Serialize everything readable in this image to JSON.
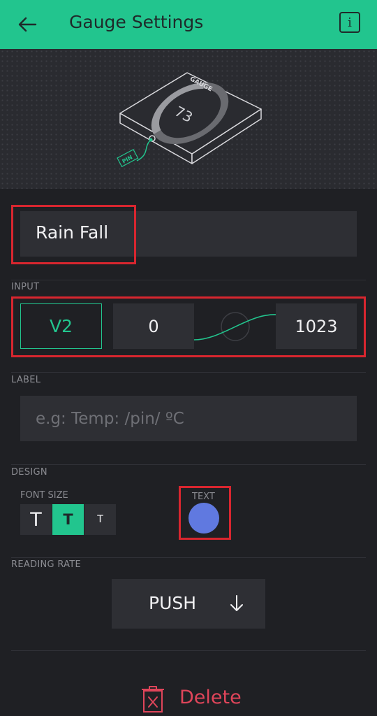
{
  "header": {
    "title": "Gauge Settings",
    "back_icon": "arrow-left-icon",
    "info_icon": "info-icon",
    "info_glyph": "i",
    "color": "#22c58e"
  },
  "preview": {
    "widget_caption": "GAUGE",
    "gauge_value": "73",
    "pin_tag": "PIN"
  },
  "name": {
    "value": "Rain Fall"
  },
  "input": {
    "section_label": "INPUT",
    "pin": "V2",
    "min": "0",
    "max": "1023"
  },
  "label": {
    "section_label": "LABEL",
    "placeholder": "e.g: Temp: /pin/ ºC"
  },
  "design": {
    "section_label": "DESIGN",
    "font_size_label": "FONT SIZE",
    "font_sizes": [
      "T",
      "T",
      "T"
    ],
    "selected_font_index": 1,
    "text_color_label": "TEXT",
    "text_color": "#6079e0"
  },
  "reading_rate": {
    "section_label": "READING RATE",
    "value": "PUSH",
    "dropdown_icon": "arrow-down-icon"
  },
  "delete": {
    "label": "Delete",
    "icon": "trash-icon",
    "color": "#e0455a"
  },
  "highlight_color": "#d8262f"
}
